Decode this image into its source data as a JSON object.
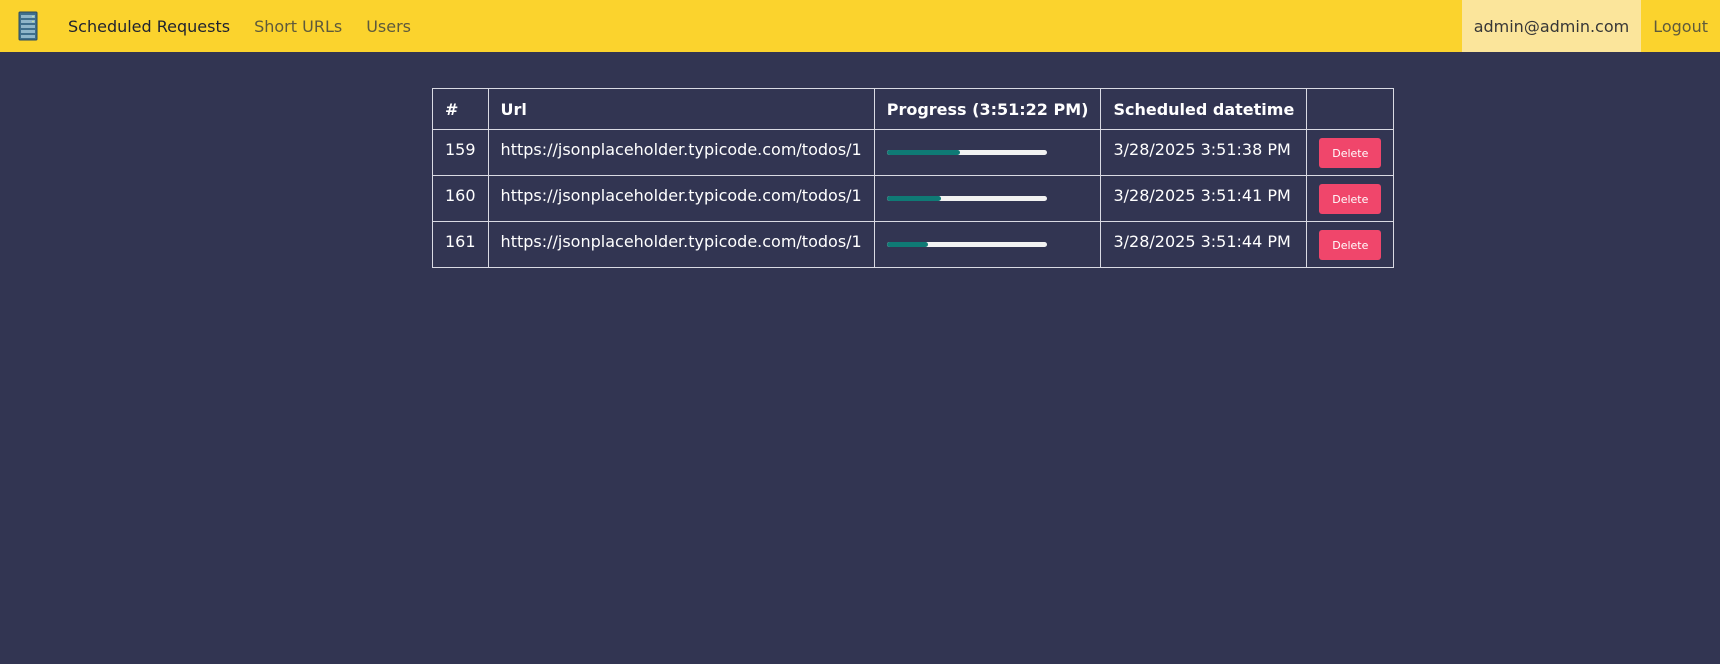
{
  "navbar": {
    "brand_icon": "server-rack-icon",
    "links": [
      {
        "label": "Scheduled Requests",
        "active": true
      },
      {
        "label": "Short URLs",
        "active": false
      },
      {
        "label": "Users",
        "active": false
      }
    ],
    "user_email": "admin@admin.com",
    "logout_label": "Logout"
  },
  "table": {
    "headers": {
      "num": "#",
      "url": "Url",
      "progress": "Progress (3:51:22 PM)",
      "scheduled": "Scheduled datetime",
      "action": ""
    },
    "rows": [
      {
        "id": "159",
        "url": "https://jsonplaceholder.typicode.com/todos/1",
        "progress": 0.46,
        "scheduled": "3/28/2025 3:51:38 PM",
        "action_label": "Delete"
      },
      {
        "id": "160",
        "url": "https://jsonplaceholder.typicode.com/todos/1",
        "progress": 0.34,
        "scheduled": "3/28/2025 3:51:41 PM",
        "action_label": "Delete"
      },
      {
        "id": "161",
        "url": "https://jsonplaceholder.typicode.com/todos/1",
        "progress": 0.26,
        "scheduled": "3/28/2025 3:51:44 PM",
        "action_label": "Delete"
      }
    ]
  },
  "colors": {
    "navbar": "#fbd32d",
    "background": "#323552",
    "progress_fill": "#0f7a75",
    "delete_button": "#f0466b"
  }
}
